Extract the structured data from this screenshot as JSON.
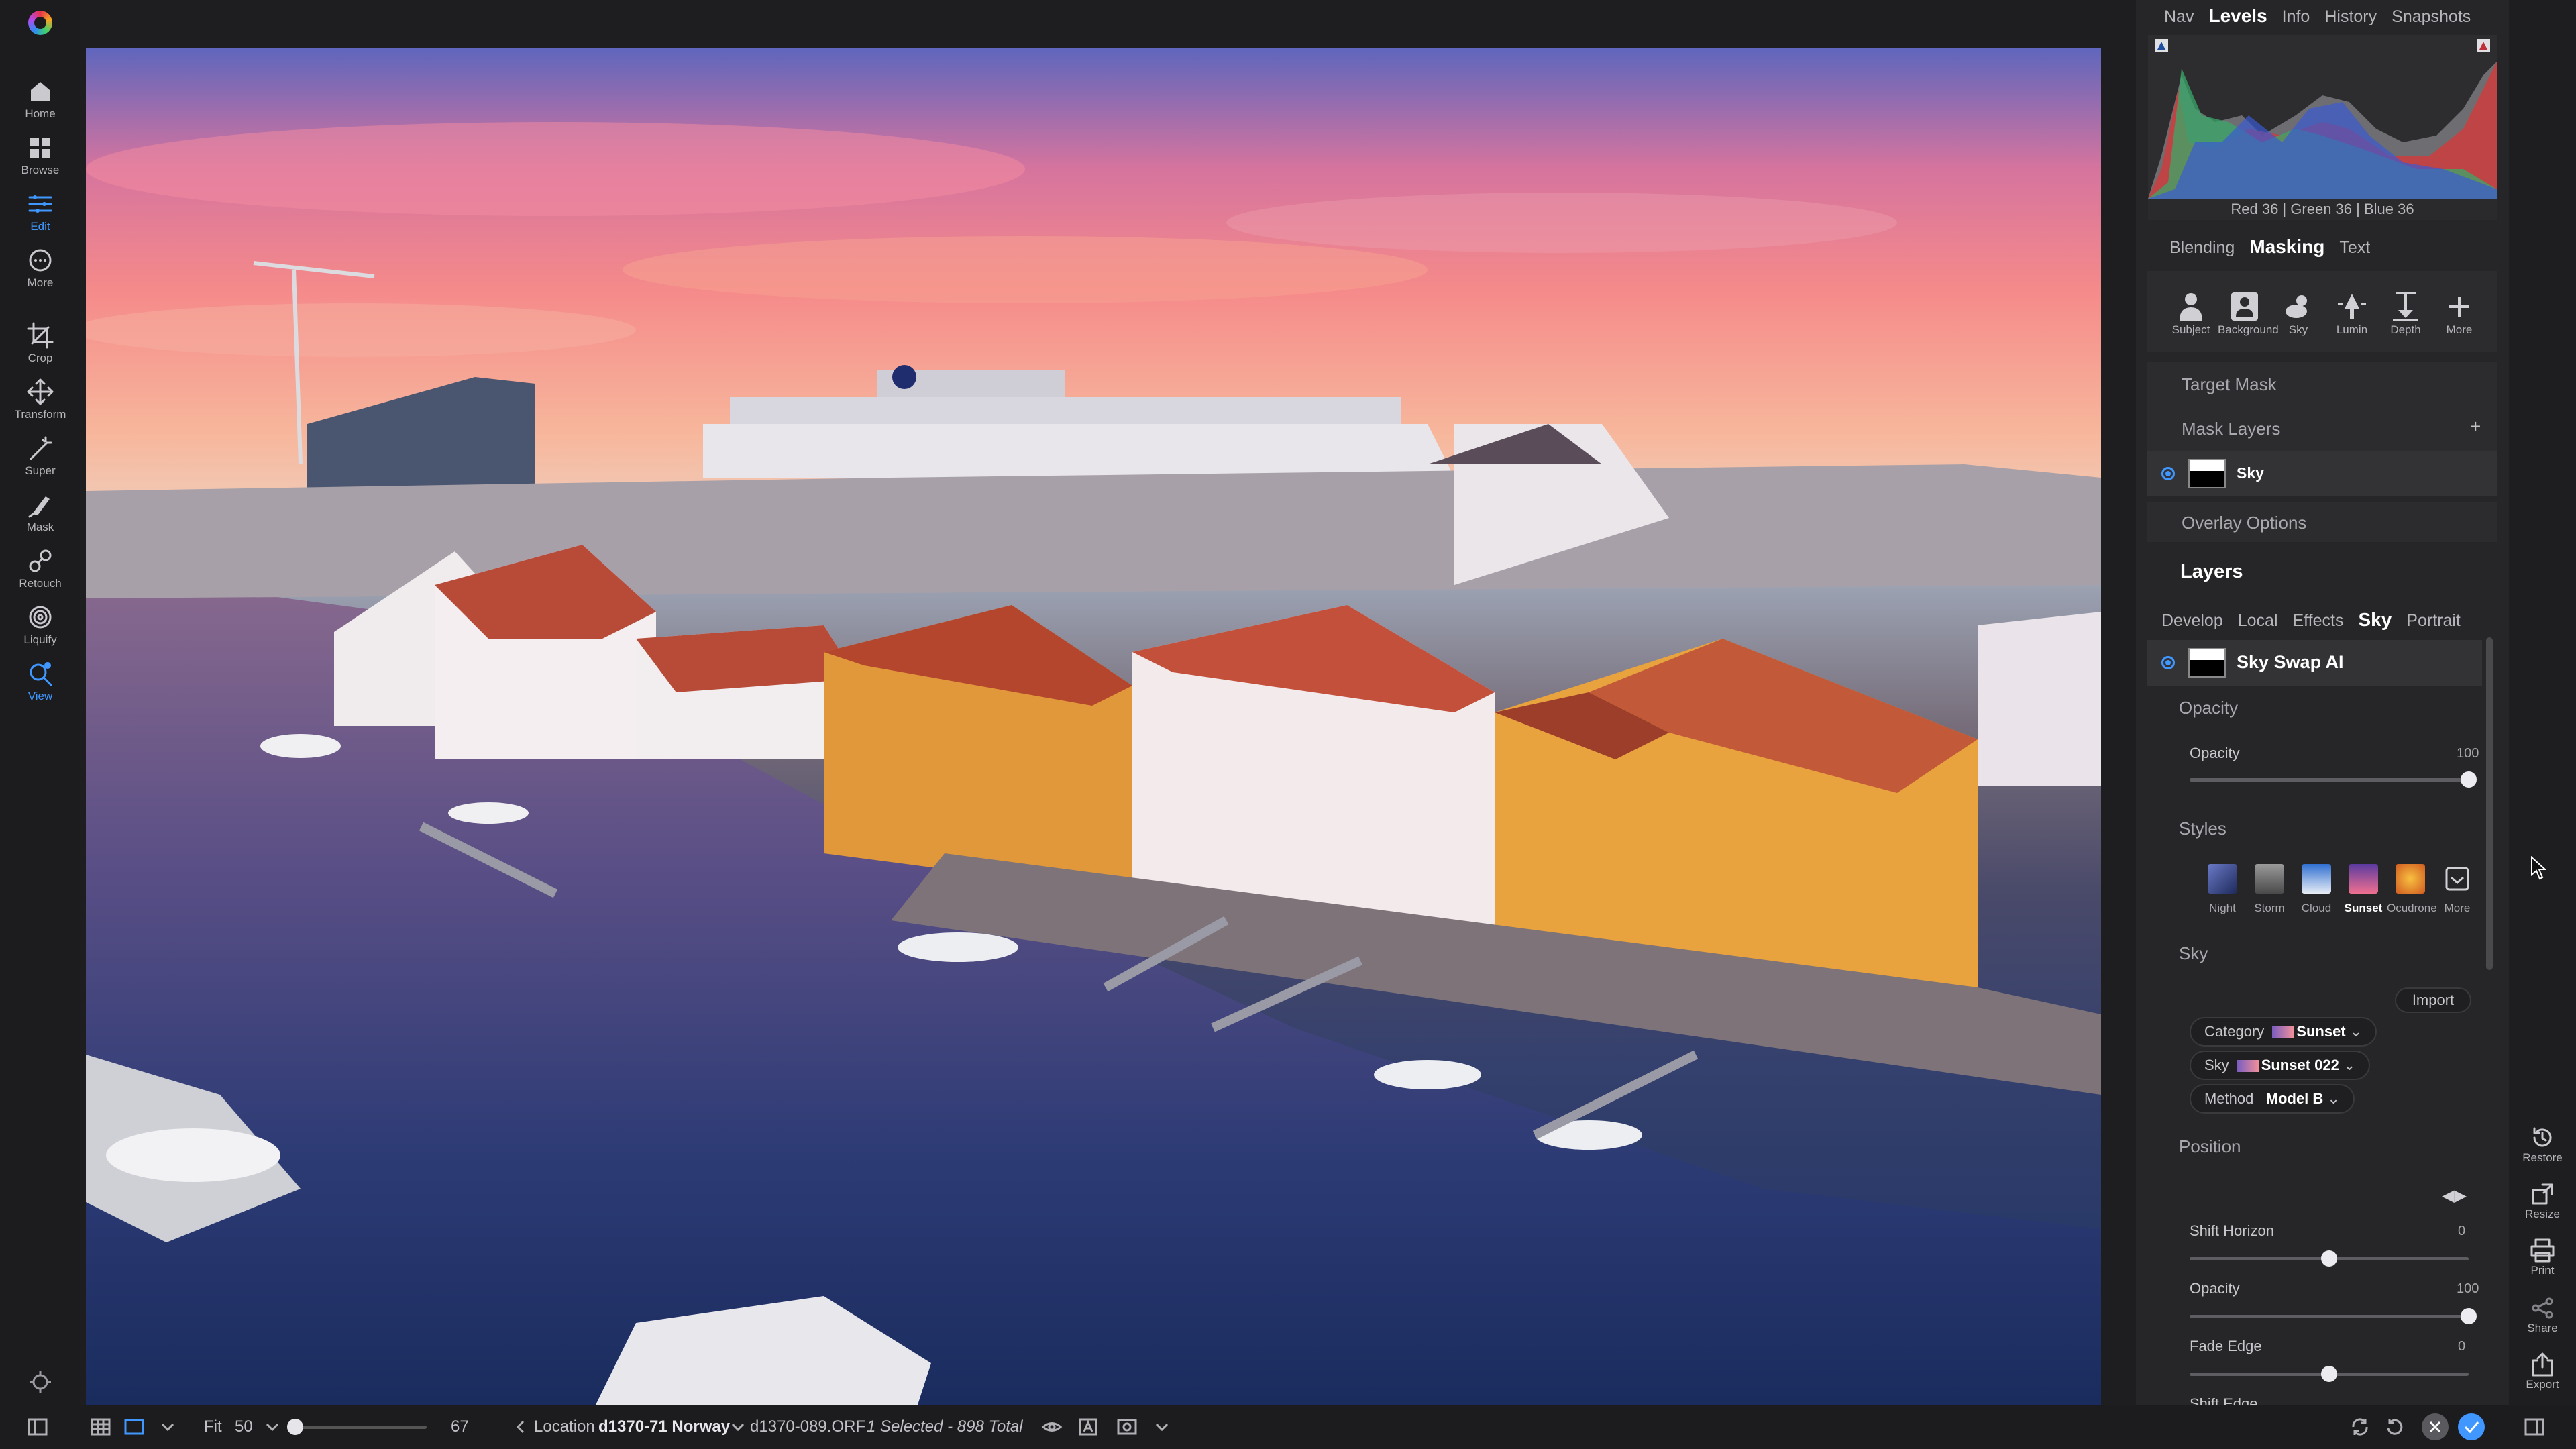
{
  "app": {
    "left_tools": [
      {
        "label": "Home",
        "icon": "home-icon"
      },
      {
        "label": "Browse",
        "icon": "grid-icon"
      },
      {
        "label": "Edit",
        "icon": "sliders-icon",
        "active": true
      },
      {
        "label": "More",
        "icon": "ellipsis-icon"
      },
      {
        "label": "Crop",
        "icon": "crop-icon"
      },
      {
        "label": "Transform",
        "icon": "move-icon"
      },
      {
        "label": "Super",
        "icon": "wand-icon"
      },
      {
        "label": "Mask",
        "icon": "brush-icon"
      },
      {
        "label": "Retouch",
        "icon": "retouch-icon"
      },
      {
        "label": "Liquify",
        "icon": "liquify-icon"
      },
      {
        "label": "View",
        "icon": "view-icon"
      }
    ]
  },
  "top_tabs": [
    "Nav",
    "Levels",
    "Info",
    "History",
    "Snapshots"
  ],
  "top_tabs_active": "Levels",
  "histogram": {
    "readout": "Red  36  | Green  36  | Blue  36",
    "colors": {
      "red": "#d23a3a",
      "green": "#3aa86a",
      "blue": "#3a5ad2",
      "gray": "#8a8a8e"
    }
  },
  "mask_tabs": [
    "Blending",
    "Masking",
    "Text"
  ],
  "mask_tabs_active": "Masking",
  "mask_tools": [
    {
      "label": "Subject",
      "icon": "person-icon"
    },
    {
      "label": "Background",
      "icon": "portrait-frame-icon"
    },
    {
      "label": "Sky",
      "icon": "cloud-sun-icon"
    },
    {
      "label": "Lumin",
      "icon": "lamp-icon"
    },
    {
      "label": "Depth",
      "icon": "depth-icon"
    },
    {
      "label": "More",
      "icon": "plus-icon"
    }
  ],
  "masking": {
    "target_mask": "Target Mask",
    "mask_layers": "Mask Layers",
    "mask_layer_name": "Sky",
    "overlay_options": "Overlay Options"
  },
  "layers": {
    "title": "Layers",
    "tabs": [
      "Develop",
      "Local",
      "Effects",
      "Sky",
      "Portrait"
    ],
    "tabs_active": "Sky",
    "active_layer": "Sky Swap AI"
  },
  "opacity_section": {
    "title": "Opacity",
    "label": "Opacity",
    "value": "100",
    "level": 1.0
  },
  "styles": {
    "title": "Styles",
    "items": [
      {
        "label": "Night",
        "color": "#3a4a8a"
      },
      {
        "label": "Storm",
        "color": "#6a6a6a"
      },
      {
        "label": "Cloud",
        "color": "#4a7ab8"
      },
      {
        "label": "Sunset",
        "color": "#b050a0",
        "active": true
      },
      {
        "label": "Ocudrone",
        "color": "#e07a2a"
      },
      {
        "label": "More",
        "color": "#262628"
      }
    ]
  },
  "sky": {
    "title": "Sky",
    "import": "Import",
    "category_label": "Category",
    "category_value": "Sunset",
    "sky_label": "Sky",
    "sky_value": "Sunset 022",
    "method_label": "Method",
    "method_value": "Model B"
  },
  "position": {
    "title": "Position",
    "sliders": [
      {
        "label": "Shift Horizon",
        "value": "0",
        "level": 0.5
      },
      {
        "label": "Opacity",
        "value": "100",
        "level": 1.0
      },
      {
        "label": "Fade Edge",
        "value": "0",
        "level": 0.5
      }
    ],
    "clipped_label": "Shift Edge"
  },
  "right_rail": [
    {
      "label": "Restore",
      "icon": "restore-icon"
    },
    {
      "label": "Resize",
      "icon": "resize-icon"
    },
    {
      "label": "Print",
      "icon": "print-icon"
    },
    {
      "label": "Share",
      "icon": "share-icon"
    },
    {
      "label": "Export",
      "icon": "export-icon"
    }
  ],
  "status_bar": {
    "fit": "Fit",
    "zoom": "50",
    "zoom_end": "67",
    "zoom_level": 0.0,
    "location_prefix": "Location",
    "location": "d1370-71 Norway",
    "filename": "d1370-089.ORF",
    "selection": "1 Selected - 898 Total"
  },
  "colors": {
    "accent": "#3f97ff",
    "panel": "#262628",
    "background": "#1e1e20"
  }
}
